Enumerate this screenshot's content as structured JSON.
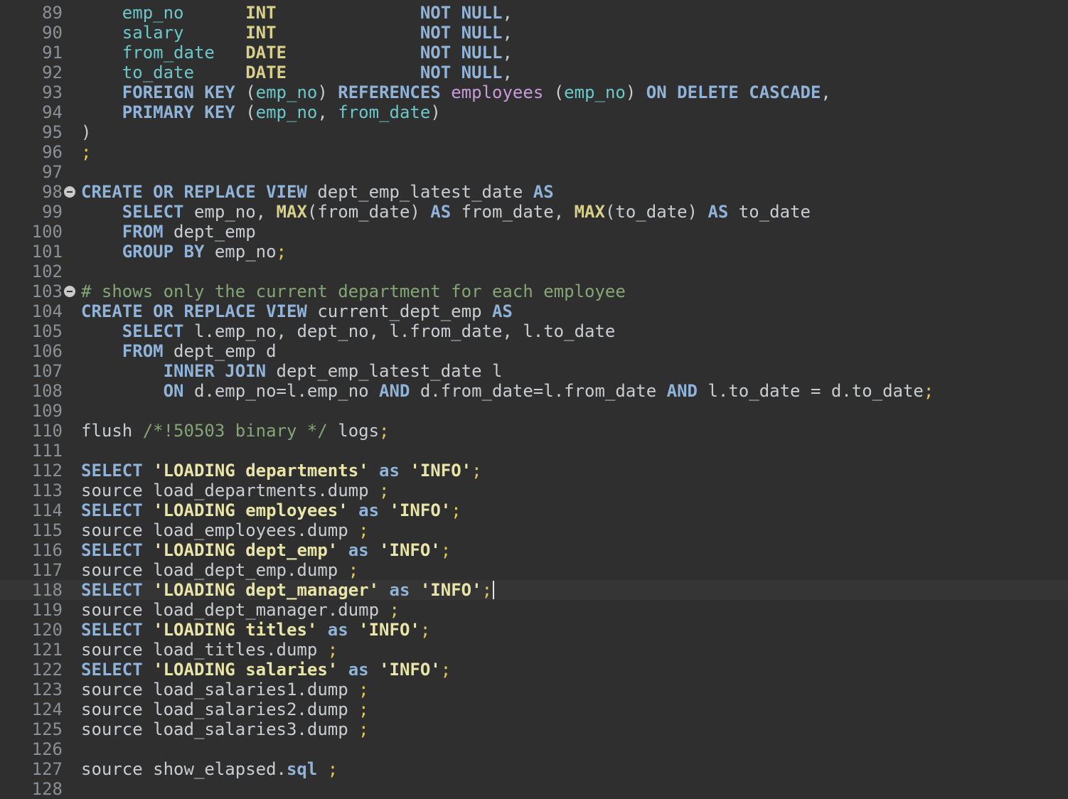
{
  "editor": {
    "language": "SQL",
    "current_line": 118,
    "colors": {
      "background": "#2f2f2f",
      "keyword": "#8fb3d9",
      "type_function": "#d9d08a",
      "identifier": "#6cc7c9",
      "table": "#c99ad9",
      "plain": "#c9cdd1",
      "punctuation": "#e6c857",
      "comment": "#84a675",
      "string": "#e9e4a8",
      "line_number": "#8a9096"
    },
    "lines": [
      {
        "num": "89",
        "tokens": [
          {
            "t": "    ",
            "c": "plain"
          },
          {
            "t": "emp_no",
            "c": "ident"
          },
          {
            "t": "      ",
            "c": "plain"
          },
          {
            "t": "INT",
            "c": "type"
          },
          {
            "t": "              ",
            "c": "plain"
          },
          {
            "t": "NOT NULL",
            "c": "kw"
          },
          {
            "t": ",",
            "c": "plain"
          }
        ]
      },
      {
        "num": "90",
        "tokens": [
          {
            "t": "    ",
            "c": "plain"
          },
          {
            "t": "salary",
            "c": "ident"
          },
          {
            "t": "      ",
            "c": "plain"
          },
          {
            "t": "INT",
            "c": "type"
          },
          {
            "t": "              ",
            "c": "plain"
          },
          {
            "t": "NOT NULL",
            "c": "kw"
          },
          {
            "t": ",",
            "c": "plain"
          }
        ]
      },
      {
        "num": "91",
        "tokens": [
          {
            "t": "    ",
            "c": "plain"
          },
          {
            "t": "from_date",
            "c": "ident"
          },
          {
            "t": "   ",
            "c": "plain"
          },
          {
            "t": "DATE",
            "c": "type"
          },
          {
            "t": "             ",
            "c": "plain"
          },
          {
            "t": "NOT NULL",
            "c": "kw"
          },
          {
            "t": ",",
            "c": "plain"
          }
        ]
      },
      {
        "num": "92",
        "tokens": [
          {
            "t": "    ",
            "c": "plain"
          },
          {
            "t": "to_date",
            "c": "ident"
          },
          {
            "t": "     ",
            "c": "plain"
          },
          {
            "t": "DATE",
            "c": "type"
          },
          {
            "t": "             ",
            "c": "plain"
          },
          {
            "t": "NOT NULL",
            "c": "kw"
          },
          {
            "t": ",",
            "c": "plain"
          }
        ]
      },
      {
        "num": "93",
        "tokens": [
          {
            "t": "    ",
            "c": "plain"
          },
          {
            "t": "FOREIGN KEY",
            "c": "kw"
          },
          {
            "t": " (",
            "c": "plain"
          },
          {
            "t": "emp_no",
            "c": "ident"
          },
          {
            "t": ") ",
            "c": "plain"
          },
          {
            "t": "REFERENCES",
            "c": "kw"
          },
          {
            "t": " ",
            "c": "plain"
          },
          {
            "t": "employees",
            "c": "table"
          },
          {
            "t": " (",
            "c": "plain"
          },
          {
            "t": "emp_no",
            "c": "ident"
          },
          {
            "t": ") ",
            "c": "plain"
          },
          {
            "t": "ON DELETE CASCADE",
            "c": "kw"
          },
          {
            "t": ",",
            "c": "plain"
          }
        ]
      },
      {
        "num": "94",
        "tokens": [
          {
            "t": "    ",
            "c": "plain"
          },
          {
            "t": "PRIMARY KEY",
            "c": "kw"
          },
          {
            "t": " (",
            "c": "plain"
          },
          {
            "t": "emp_no",
            "c": "ident"
          },
          {
            "t": ", ",
            "c": "plain"
          },
          {
            "t": "from_date",
            "c": "ident"
          },
          {
            "t": ")",
            "c": "plain"
          }
        ]
      },
      {
        "num": "95",
        "tokens": [
          {
            "t": ")",
            "c": "plain"
          }
        ]
      },
      {
        "num": "96",
        "tokens": [
          {
            "t": ";",
            "c": "punct"
          }
        ]
      },
      {
        "num": "97",
        "tokens": []
      },
      {
        "num": "98",
        "fold": true,
        "tokens": [
          {
            "t": "CREATE OR REPLACE VIEW",
            "c": "kw"
          },
          {
            "t": " dept_emp_latest_date ",
            "c": "plain"
          },
          {
            "t": "AS",
            "c": "kw"
          }
        ]
      },
      {
        "num": "99",
        "tokens": [
          {
            "t": "    ",
            "c": "plain"
          },
          {
            "t": "SELECT",
            "c": "kw"
          },
          {
            "t": " emp_no, ",
            "c": "plain"
          },
          {
            "t": "MAX",
            "c": "fn"
          },
          {
            "t": "(from_date) ",
            "c": "plain"
          },
          {
            "t": "AS",
            "c": "kw"
          },
          {
            "t": " from_date, ",
            "c": "plain"
          },
          {
            "t": "MAX",
            "c": "fn"
          },
          {
            "t": "(to_date) ",
            "c": "plain"
          },
          {
            "t": "AS",
            "c": "kw"
          },
          {
            "t": " to_date",
            "c": "plain"
          }
        ]
      },
      {
        "num": "100",
        "tokens": [
          {
            "t": "    ",
            "c": "plain"
          },
          {
            "t": "FROM",
            "c": "kw"
          },
          {
            "t": " dept_emp",
            "c": "plain"
          }
        ]
      },
      {
        "num": "101",
        "tokens": [
          {
            "t": "    ",
            "c": "plain"
          },
          {
            "t": "GROUP BY",
            "c": "kw"
          },
          {
            "t": " emp_no",
            "c": "plain"
          },
          {
            "t": ";",
            "c": "punct"
          }
        ]
      },
      {
        "num": "102",
        "tokens": []
      },
      {
        "num": "103",
        "fold": true,
        "tokens": [
          {
            "t": "# shows only the current department for each employee",
            "c": "comment"
          }
        ]
      },
      {
        "num": "104",
        "tokens": [
          {
            "t": "CREATE OR REPLACE VIEW",
            "c": "kw"
          },
          {
            "t": " current_dept_emp ",
            "c": "plain"
          },
          {
            "t": "AS",
            "c": "kw"
          }
        ]
      },
      {
        "num": "105",
        "tokens": [
          {
            "t": "    ",
            "c": "plain"
          },
          {
            "t": "SELECT",
            "c": "kw"
          },
          {
            "t": " l.emp_no, dept_no, l.from_date, l.to_date",
            "c": "plain"
          }
        ]
      },
      {
        "num": "106",
        "tokens": [
          {
            "t": "    ",
            "c": "plain"
          },
          {
            "t": "FROM",
            "c": "kw"
          },
          {
            "t": " dept_emp d",
            "c": "plain"
          }
        ]
      },
      {
        "num": "107",
        "tokens": [
          {
            "t": "        ",
            "c": "plain"
          },
          {
            "t": "INNER JOIN",
            "c": "kw"
          },
          {
            "t": " dept_emp_latest_date l",
            "c": "plain"
          }
        ]
      },
      {
        "num": "108",
        "tokens": [
          {
            "t": "        ",
            "c": "plain"
          },
          {
            "t": "ON",
            "c": "kw"
          },
          {
            "t": " d.emp_no=l.emp_no ",
            "c": "plain"
          },
          {
            "t": "AND",
            "c": "kw"
          },
          {
            "t": " d.from_date=l.from_date ",
            "c": "plain"
          },
          {
            "t": "AND",
            "c": "kw"
          },
          {
            "t": " l.to_date = d.to_date",
            "c": "plain"
          },
          {
            "t": ";",
            "c": "punct"
          }
        ]
      },
      {
        "num": "109",
        "tokens": []
      },
      {
        "num": "110",
        "tokens": [
          {
            "t": "flush ",
            "c": "plain"
          },
          {
            "t": "/*!50503 binary */",
            "c": "comment"
          },
          {
            "t": " logs",
            "c": "plain"
          },
          {
            "t": ";",
            "c": "punct"
          }
        ]
      },
      {
        "num": "111",
        "tokens": []
      },
      {
        "num": "112",
        "tokens": [
          {
            "t": "SELECT",
            "c": "kw"
          },
          {
            "t": " ",
            "c": "plain"
          },
          {
            "t": "'LOADING departments'",
            "c": "str"
          },
          {
            "t": " ",
            "c": "plain"
          },
          {
            "t": "as",
            "c": "kw"
          },
          {
            "t": " ",
            "c": "plain"
          },
          {
            "t": "'INFO'",
            "c": "str"
          },
          {
            "t": ";",
            "c": "punct"
          }
        ]
      },
      {
        "num": "113",
        "tokens": [
          {
            "t": "source load_departments.dump ",
            "c": "plain"
          },
          {
            "t": ";",
            "c": "punct"
          }
        ]
      },
      {
        "num": "114",
        "tokens": [
          {
            "t": "SELECT",
            "c": "kw"
          },
          {
            "t": " ",
            "c": "plain"
          },
          {
            "t": "'LOADING employees'",
            "c": "str"
          },
          {
            "t": " ",
            "c": "plain"
          },
          {
            "t": "as",
            "c": "kw"
          },
          {
            "t": " ",
            "c": "plain"
          },
          {
            "t": "'INFO'",
            "c": "str"
          },
          {
            "t": ";",
            "c": "punct"
          }
        ]
      },
      {
        "num": "115",
        "tokens": [
          {
            "t": "source load_employees.dump ",
            "c": "plain"
          },
          {
            "t": ";",
            "c": "punct"
          }
        ]
      },
      {
        "num": "116",
        "tokens": [
          {
            "t": "SELECT",
            "c": "kw"
          },
          {
            "t": " ",
            "c": "plain"
          },
          {
            "t": "'LOADING dept_emp'",
            "c": "str"
          },
          {
            "t": " ",
            "c": "plain"
          },
          {
            "t": "as",
            "c": "kw"
          },
          {
            "t": " ",
            "c": "plain"
          },
          {
            "t": "'INFO'",
            "c": "str"
          },
          {
            "t": ";",
            "c": "punct"
          }
        ]
      },
      {
        "num": "117",
        "tokens": [
          {
            "t": "source load_dept_emp.dump ",
            "c": "plain"
          },
          {
            "t": ";",
            "c": "punct"
          }
        ]
      },
      {
        "num": "118",
        "current": true,
        "tokens": [
          {
            "t": "SELECT",
            "c": "kw"
          },
          {
            "t": " ",
            "c": "plain"
          },
          {
            "t": "'LOADING dept_manager'",
            "c": "str"
          },
          {
            "t": " ",
            "c": "plain"
          },
          {
            "t": "as",
            "c": "kw"
          },
          {
            "t": " ",
            "c": "plain"
          },
          {
            "t": "'INFO'",
            "c": "str"
          },
          {
            "t": ";",
            "c": "punct"
          }
        ]
      },
      {
        "num": "119",
        "tokens": [
          {
            "t": "source load_dept_manager.dump ",
            "c": "plain"
          },
          {
            "t": ";",
            "c": "punct"
          }
        ]
      },
      {
        "num": "120",
        "tokens": [
          {
            "t": "SELECT",
            "c": "kw"
          },
          {
            "t": " ",
            "c": "plain"
          },
          {
            "t": "'LOADING titles'",
            "c": "str"
          },
          {
            "t": " ",
            "c": "plain"
          },
          {
            "t": "as",
            "c": "kw"
          },
          {
            "t": " ",
            "c": "plain"
          },
          {
            "t": "'INFO'",
            "c": "str"
          },
          {
            "t": ";",
            "c": "punct"
          }
        ]
      },
      {
        "num": "121",
        "tokens": [
          {
            "t": "source load_titles.dump ",
            "c": "plain"
          },
          {
            "t": ";",
            "c": "punct"
          }
        ]
      },
      {
        "num": "122",
        "tokens": [
          {
            "t": "SELECT",
            "c": "kw"
          },
          {
            "t": " ",
            "c": "plain"
          },
          {
            "t": "'LOADING salaries'",
            "c": "str"
          },
          {
            "t": " ",
            "c": "plain"
          },
          {
            "t": "as",
            "c": "kw"
          },
          {
            "t": " ",
            "c": "plain"
          },
          {
            "t": "'INFO'",
            "c": "str"
          },
          {
            "t": ";",
            "c": "punct"
          }
        ]
      },
      {
        "num": "123",
        "tokens": [
          {
            "t": "source load_salaries1.dump ",
            "c": "plain"
          },
          {
            "t": ";",
            "c": "punct"
          }
        ]
      },
      {
        "num": "124",
        "tokens": [
          {
            "t": "source load_salaries2.dump ",
            "c": "plain"
          },
          {
            "t": ";",
            "c": "punct"
          }
        ]
      },
      {
        "num": "125",
        "tokens": [
          {
            "t": "source load_salaries3.dump ",
            "c": "plain"
          },
          {
            "t": ";",
            "c": "punct"
          }
        ]
      },
      {
        "num": "126",
        "tokens": []
      },
      {
        "num": "127",
        "tokens": [
          {
            "t": "source show_elapsed.",
            "c": "plain"
          },
          {
            "t": "sql",
            "c": "kw"
          },
          {
            "t": " ",
            "c": "plain"
          },
          {
            "t": ";",
            "c": "punct"
          }
        ]
      },
      {
        "num": "128",
        "tokens": []
      }
    ]
  }
}
